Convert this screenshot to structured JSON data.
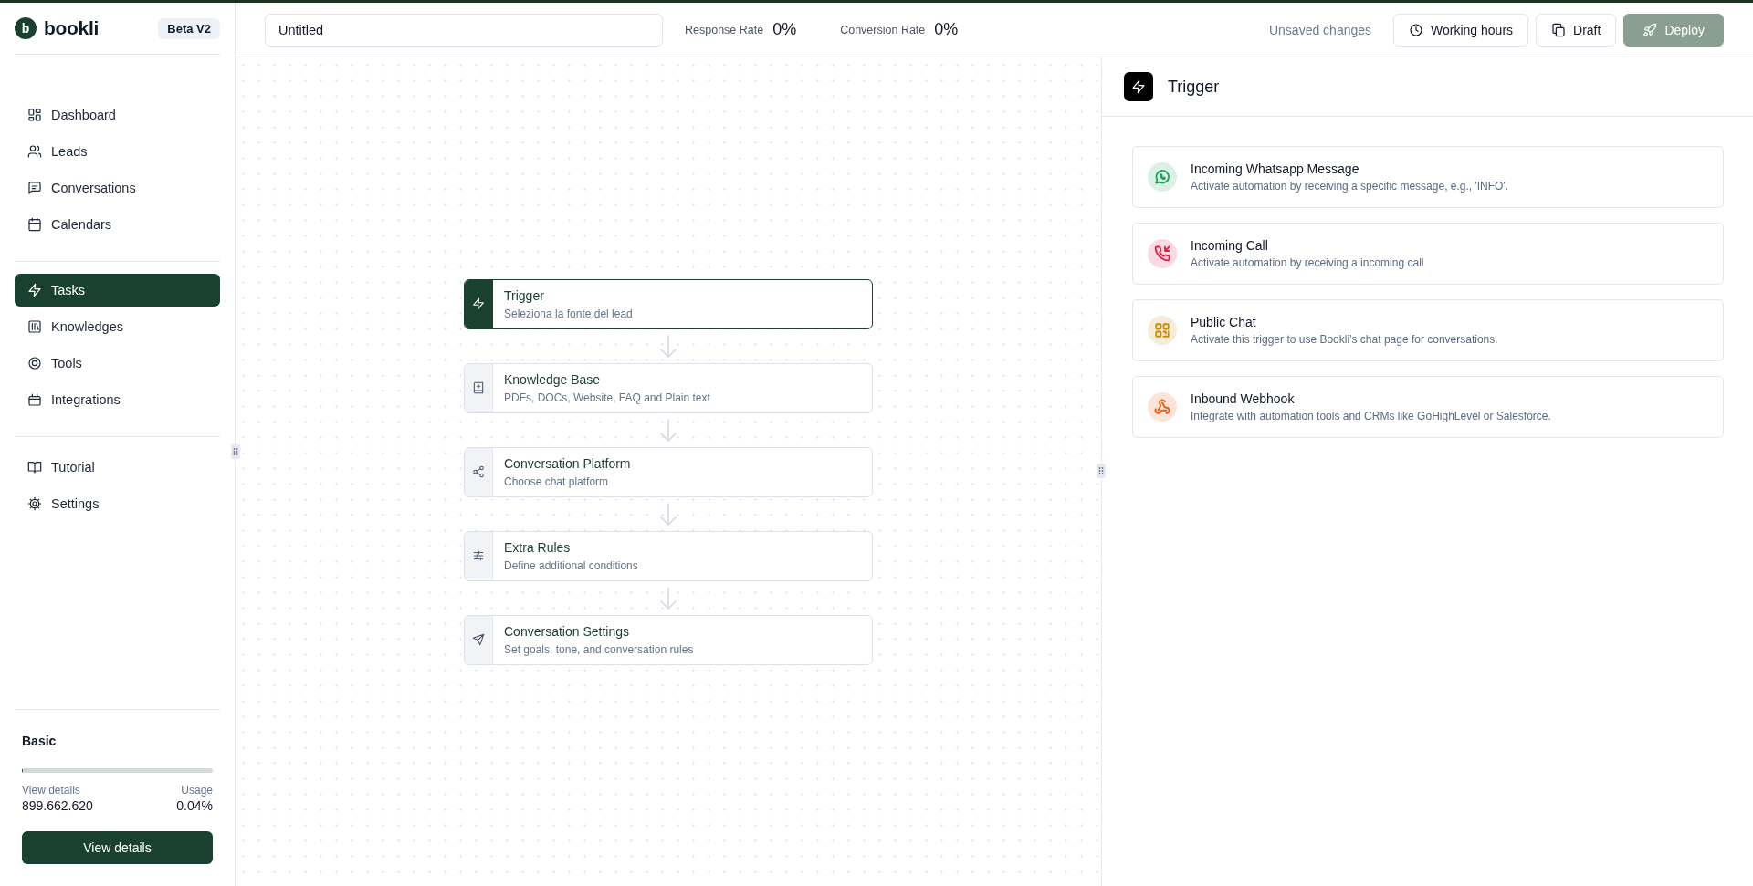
{
  "sidebar": {
    "logo": {
      "letter": "b",
      "name": "bookli"
    },
    "badge": "Beta V2",
    "nav_groups": [
      [
        {
          "label": "Dashboard",
          "selected": false
        },
        {
          "label": "Leads",
          "selected": false
        },
        {
          "label": "Conversations",
          "selected": false
        },
        {
          "label": "Calendars",
          "selected": false
        }
      ],
      [
        {
          "label": "Tasks",
          "selected": true
        },
        {
          "label": "Knowledges",
          "selected": false
        },
        {
          "label": "Tools",
          "selected": false
        },
        {
          "label": "Integrations",
          "selected": false
        }
      ],
      [
        {
          "label": "Tutorial",
          "selected": false
        },
        {
          "label": "Settings",
          "selected": false
        }
      ]
    ],
    "plan": {
      "name": "Basic",
      "level": 0.0004,
      "left_label": "View details",
      "left_value": "899.662.620",
      "right_label": "Usage",
      "right_value": "0.04%",
      "button": "View details"
    }
  },
  "header": {
    "title_field": {
      "value": "Untitled"
    },
    "stats": [
      {
        "label": "Response Rate",
        "value": "0%"
      },
      {
        "label": "Conversion Rate",
        "value": "0%"
      }
    ],
    "status": "Unsaved changes",
    "buttons": [
      {
        "label": "Working hours",
        "kind": "clock",
        "disabled": false
      },
      {
        "label": "Draft",
        "kind": "copy",
        "disabled": false
      },
      {
        "label": "Deploy",
        "kind": "rocket",
        "disabled": true
      }
    ]
  },
  "flow": {
    "steps": [
      {
        "title": "Trigger",
        "subtitle": "Seleziona la fonte del lead",
        "selected": true
      },
      {
        "title": "Knowledge Base",
        "subtitle": "PDFs, DOCs, Website, FAQ and Plain text",
        "selected": false
      },
      {
        "title": "Conversation Platform",
        "subtitle": "Choose chat platform",
        "selected": false
      },
      {
        "title": "Extra Rules",
        "subtitle": "Define additional conditions",
        "selected": false
      },
      {
        "title": "Conversation Settings",
        "subtitle": "Set goals, tone, and conversation rules",
        "selected": false
      }
    ]
  },
  "panel": {
    "title": "Trigger",
    "options": [
      {
        "title": "Incoming Whatsapp Message",
        "description": "Activate automation by receiving a specific message, e.g., 'INFO'.",
        "color": "#22a35a"
      },
      {
        "title": "Incoming Call",
        "description": "Activate automation by receiving a incoming call",
        "color": "#e11d48"
      },
      {
        "title": "Public Chat",
        "description": "Activate this trigger to use Bookli’s chat page for conversations.",
        "color": "#ca8a04"
      },
      {
        "title": "Inbound Webhook",
        "description": "Integrate with automation tools and CRMs like GoHighLevel or Salesforce.",
        "color": "#ea580c"
      }
    ]
  }
}
